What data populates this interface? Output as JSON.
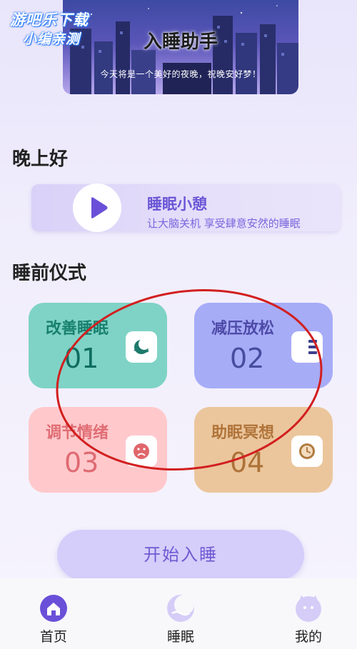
{
  "banner": {
    "title": "入睡助手",
    "subtitle": "今天将是一个美好的夜晚，祝晚安好梦！"
  },
  "watermark": {
    "line1": "游吧乐下载",
    "line2": "小编亲测"
  },
  "greeting": "晚上好",
  "nap_card": {
    "title": "睡眠小憩",
    "description": "让大脑关机 享受肆意安然的睡眠",
    "icon": "play-icon"
  },
  "rituals": {
    "section_title": "睡前仪式",
    "items": [
      {
        "label": "改善睡眠",
        "number": "01",
        "icon": "moon-wave-icon",
        "color": "#7fd3c6"
      },
      {
        "label": "减压放松",
        "number": "02",
        "icon": "stack-icon",
        "color": "#a7acf7"
      },
      {
        "label": "调节情绪",
        "number": "03",
        "icon": "sad-face-icon",
        "color": "#ffc9cc"
      },
      {
        "label": "助眠冥想",
        "number": "04",
        "icon": "moon-clock-icon",
        "color": "#ebc69c"
      }
    ]
  },
  "start_button": "开始入睡",
  "bottom_nav": {
    "items": [
      {
        "label": "首页",
        "icon": "home-icon",
        "active": true
      },
      {
        "label": "睡眠",
        "icon": "moon-icon",
        "active": false
      },
      {
        "label": "我的",
        "icon": "face-icon",
        "active": false
      }
    ]
  },
  "colors": {
    "accent": "#6a55d6",
    "annotation": "#d21f1f"
  }
}
